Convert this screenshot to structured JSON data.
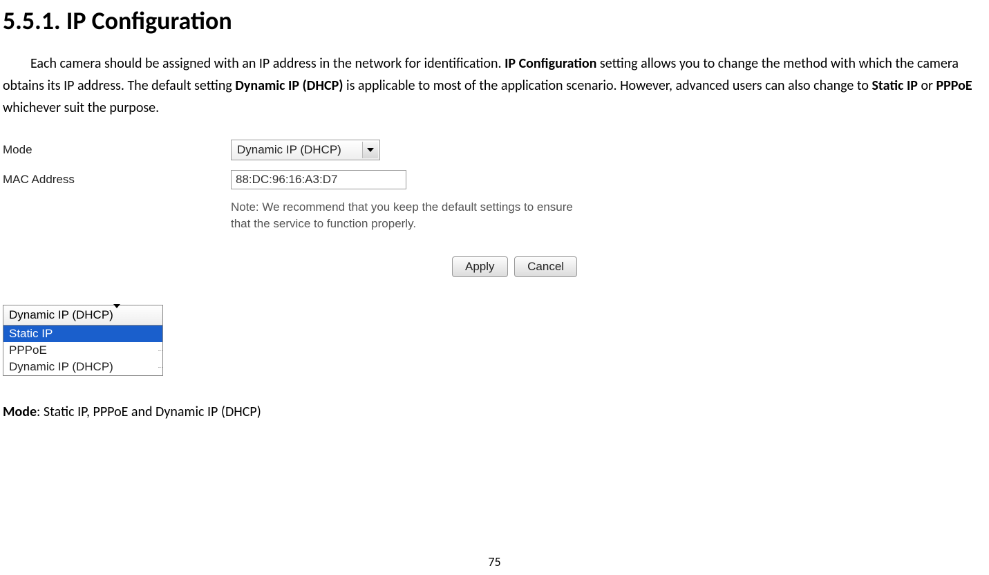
{
  "heading": "5.5.1.   IP Configuration",
  "paragraph": {
    "t1": "Each camera should be assigned with an IP address in the network for identification. ",
    "b1": "IP Configuration",
    "t2": " setting allows you to change the method with which the camera obtains its IP address. The default setting ",
    "b2": "Dynamic IP (DHCP)",
    "t3": " is applicable to most of the application scenario. However, advanced users can also change to ",
    "b3": "Static IP",
    "t4": " or ",
    "b4": "PPPoE",
    "t5": " whichever suit the purpose."
  },
  "form": {
    "mode_label": "Mode",
    "mode_value": "Dynamic IP (DHCP)",
    "mac_label": "MAC Address",
    "mac_value": "88:DC:96:16:A3:D7",
    "note": "Note: We recommend that you keep the default settings to ensure that the service to function properly."
  },
  "buttons": {
    "apply": "Apply",
    "cancel": "Cancel"
  },
  "dropdown": {
    "collapsed": "Dynamic IP (DHCP)",
    "opt1": "Static IP",
    "opt2": "PPPoE",
    "opt3": "Dynamic IP (DHCP)"
  },
  "bottom": {
    "label": "Mode",
    "colon": ": ",
    "value": "Static IP, PPPoE and Dynamic IP (DHCP)"
  },
  "page_number": "75"
}
